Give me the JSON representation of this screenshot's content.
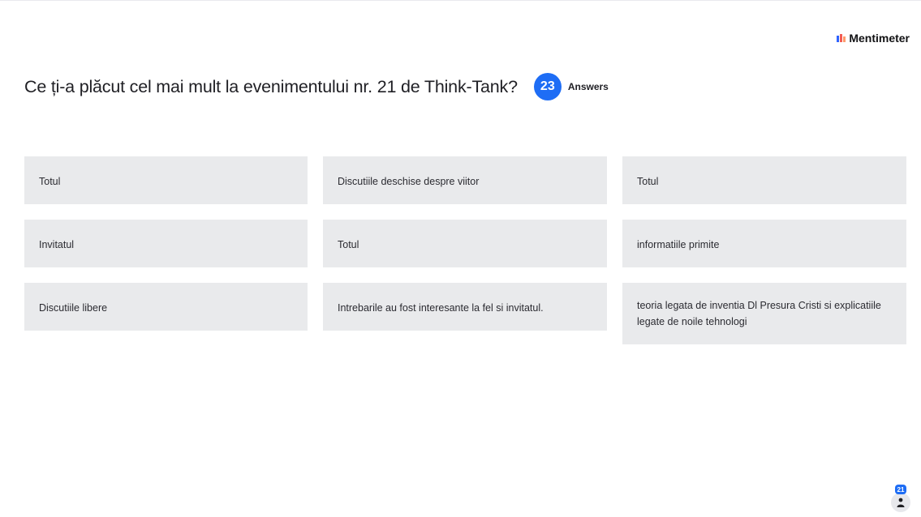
{
  "brand": {
    "name": "Mentimeter",
    "logo_icon": "mentimeter-bars-icon",
    "colors": [
      "#2f64ff",
      "#f25c54",
      "#ff9b6b"
    ]
  },
  "question": {
    "text": "Ce ți-a plăcut cel mai mult la evenimentului nr. 21 de Think-Tank?",
    "answer_count": "23",
    "answer_label": "Answers"
  },
  "responses": [
    {
      "text": "Totul"
    },
    {
      "text": "Discutiile deschise despre viitor"
    },
    {
      "text": "Totul"
    },
    {
      "text": "Invitatul"
    },
    {
      "text": "Totul"
    },
    {
      "text": "informatiile primite"
    },
    {
      "text": "Discutiile libere"
    },
    {
      "text": "Intrebarile au fost interesante la fel si invitatul."
    },
    {
      "text": "teoria legata de inventia Dl Presura Cristi si explicatiile legate de noile tehnologi"
    }
  ],
  "participants": {
    "count": "21",
    "icon": "person-icon"
  },
  "colors": {
    "accent": "#1e6df5",
    "card_background": "#e9eaec",
    "text": "#1f1f24"
  }
}
